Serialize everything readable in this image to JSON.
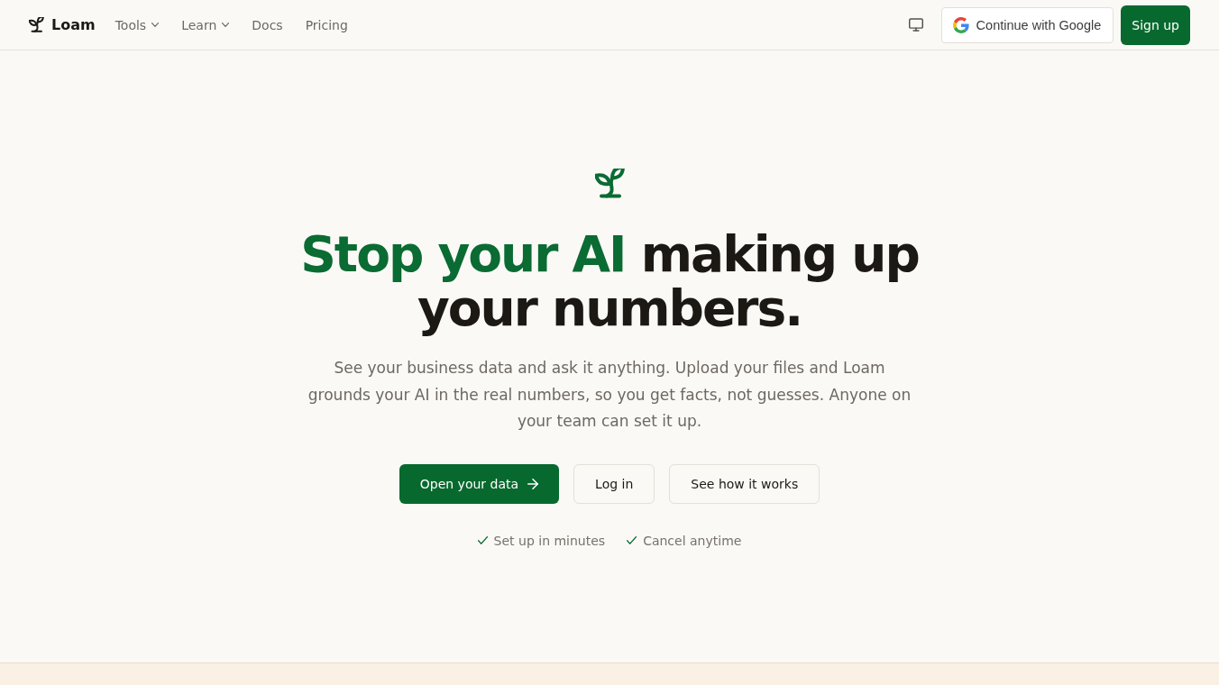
{
  "nav": {
    "brand": "Loam",
    "links": [
      {
        "label": "Tools",
        "kind": "dropdown"
      },
      {
        "label": "Learn",
        "kind": "dropdown"
      },
      {
        "label": "Docs",
        "kind": "link"
      },
      {
        "label": "Pricing",
        "kind": "link"
      }
    ],
    "google_button": "Continue with Google",
    "signup_button": "Sign up"
  },
  "hero": {
    "heading_highlight": "Stop your AI",
    "heading_rest": "making up your numbers.",
    "description": "See your business data and ask it anything. Upload your files and Loam grounds your AI in the real numbers, so you get facts, not guesses. Anyone on your team can set it up.",
    "buttons": [
      {
        "label": "Open your data",
        "kind": "primary"
      },
      {
        "label": "Log in",
        "kind": "secondary"
      },
      {
        "label": "See how it works",
        "kind": "secondary"
      }
    ],
    "features": [
      "Set up in minutes",
      "Cancel anytime"
    ]
  }
}
